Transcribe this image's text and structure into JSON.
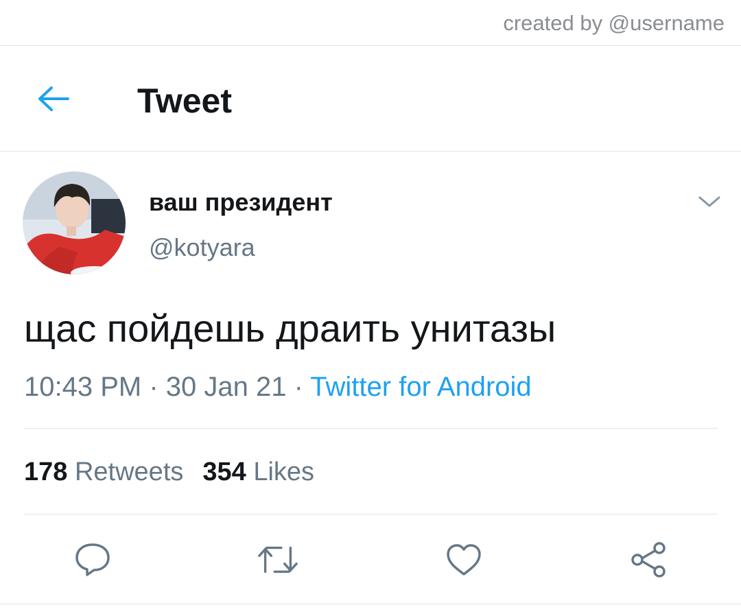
{
  "watermark": {
    "text": "created by @username"
  },
  "header": {
    "title": "Tweet",
    "back_icon": "arrow-left-icon",
    "accent": "#1da1f2"
  },
  "tweet": {
    "author": {
      "display_name": "ваш президент",
      "handle": "@kotyara",
      "avatar_icon": "profile-photo"
    },
    "menu_icon": "chevron-down-icon",
    "text": "щас пойдешь драить унитазы",
    "time": "10:43 PM",
    "date": "30 Jan 21",
    "separator": " · ",
    "source": "Twitter for Android",
    "stats": {
      "retweets_count": "178",
      "retweets_label": "Retweets",
      "likes_count": "354",
      "likes_label": "Likes"
    }
  },
  "actions": [
    {
      "icon": "reply-icon"
    },
    {
      "icon": "retweet-icon"
    },
    {
      "icon": "like-icon"
    },
    {
      "icon": "share-icon"
    }
  ],
  "colors": {
    "text": "#14171a",
    "secondary": "#657786",
    "link": "#1da1f2",
    "divider": "#e1e4e8"
  }
}
